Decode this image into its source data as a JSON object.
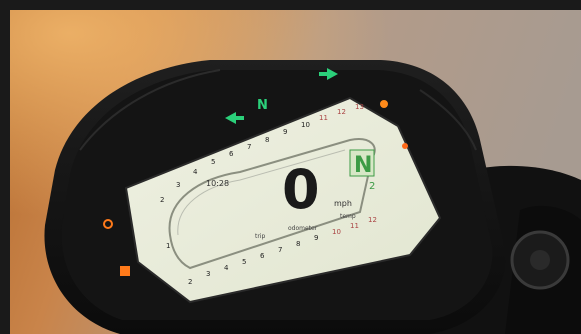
{
  "photo": {
    "description": "",
    "dashboard": {
      "speed_value": "0",
      "speed_unit": "mph",
      "gear_indicator": "N",
      "gear_indicator_small": "2",
      "time_readout": "10:28",
      "scale_top": [
        "2",
        "3",
        "4",
        "5",
        "6",
        "7",
        "8",
        "9",
        "10",
        "11",
        "12",
        "13"
      ],
      "scale_bottom": [
        "1",
        "2",
        "3",
        "4",
        "5",
        "6",
        "7",
        "8",
        "9",
        "10",
        "11",
        "12"
      ],
      "bottom_labels": [
        "trip",
        "odometer",
        "temp"
      ],
      "warning_lights": {
        "left_turn_color": "#2bd07a",
        "neutral_color": "#2bd07a",
        "right_turn_color": "#2bd07a",
        "warning_amber_color": "#ff8a1a",
        "warning_orange_color": "#ff6a1a"
      }
    }
  }
}
